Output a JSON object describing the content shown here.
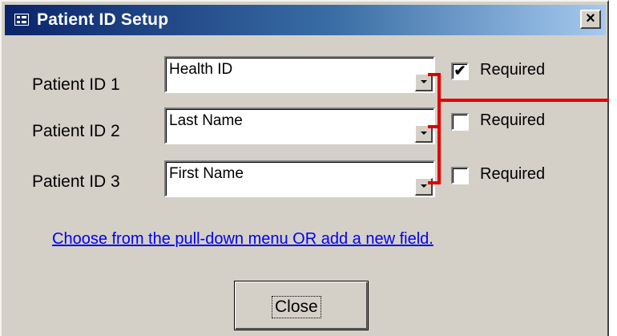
{
  "window": {
    "title": "Patient ID Setup",
    "close_glyph": "×",
    "title_icon": "form-icon"
  },
  "fields": [
    {
      "label": "Patient ID 1",
      "value": "Health ID",
      "required_label": "Required",
      "required": true
    },
    {
      "label": "Patient ID 2",
      "value": "Last Name",
      "required_label": "Required",
      "required": false
    },
    {
      "label": "Patient ID 3",
      "value": "First Name",
      "required_label": "Required",
      "required": false
    }
  ],
  "hint_link": "Choose from the pull-down menu OR add a new field.",
  "close_button": "Close",
  "colors": {
    "title_bar_start": "#0a246a",
    "title_bar_end": "#a6caf0",
    "dialog_face": "#d4d0c8",
    "annotation_bracket": "#e00000",
    "link": "#0000ee"
  }
}
